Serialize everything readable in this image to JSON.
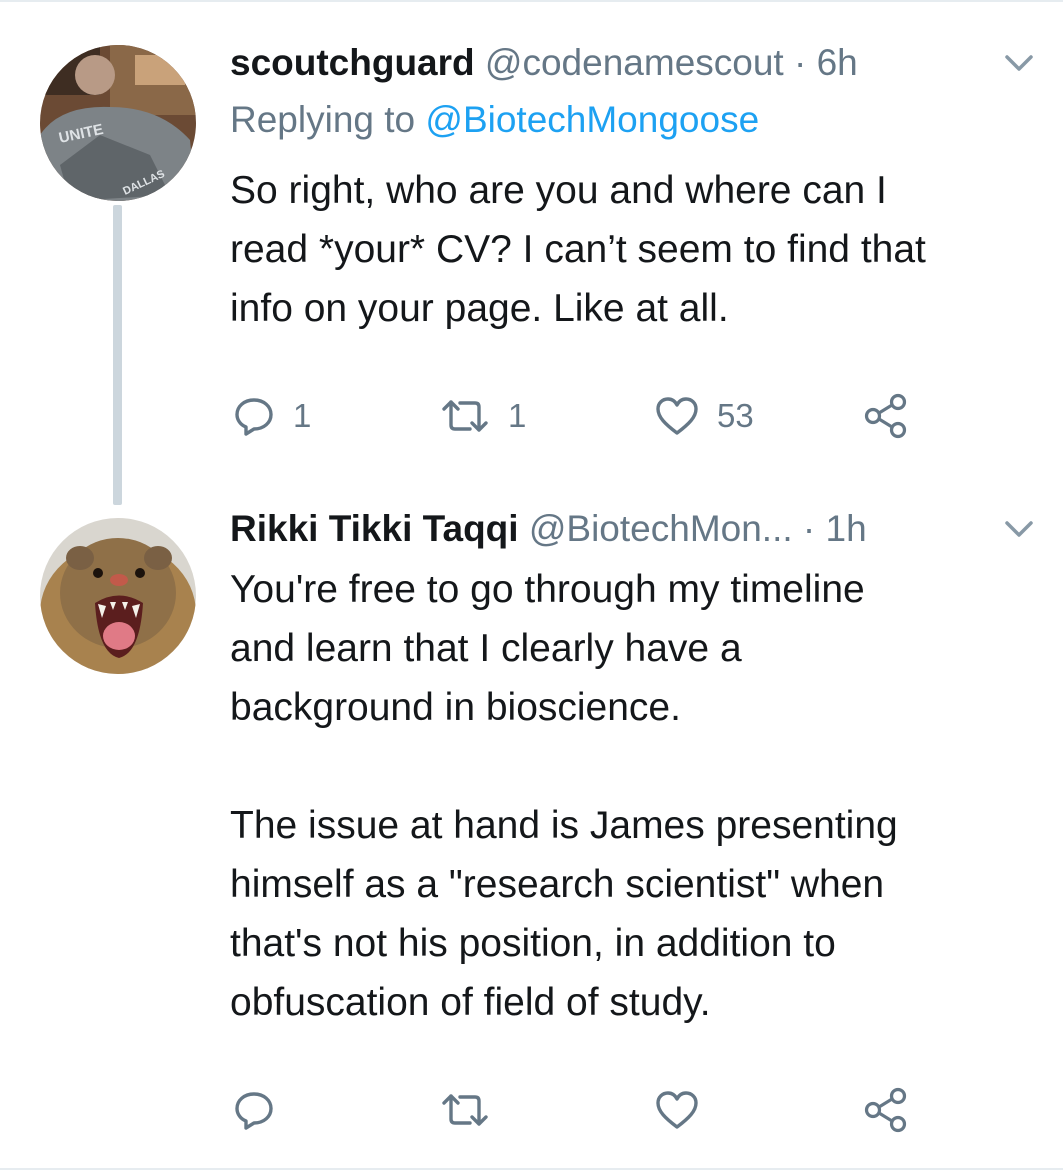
{
  "tweets": [
    {
      "display_name": "scoutchguard",
      "handle": "@codenamescout",
      "separator": "·",
      "time": "6h",
      "replying_prefix": "Replying to",
      "replying_to": "@BiotechMongoose",
      "text": "So right, who are you and where can I\nread *your* CV? I can’t seem to find that\ninfo on your page. Like at all.",
      "avatar_shirt_text": "UNITE",
      "avatar_shirt_text2": "DALLAS",
      "actions": {
        "reply_count": "1",
        "retweet_count": "1",
        "like_count": "53"
      }
    },
    {
      "display_name": "Rikki Tikki Taqqi",
      "handle": "@BiotechMon...",
      "separator": "·",
      "time": "1h",
      "text": "You're free to go through my timeline\nand learn that I clearly have a\nbackground in bioscience.\n\nThe issue at hand is James presenting\nhimself as a \"research scientist\" when\nthat's not his position, in addition to\nobfuscation of field of study.",
      "actions": {
        "reply_count": "",
        "retweet_count": "",
        "like_count": ""
      }
    }
  ],
  "icons": {
    "reply": "reply-icon",
    "retweet": "retweet-icon",
    "like": "like-icon",
    "share": "share-icon",
    "caret": "chevron-down-icon"
  },
  "colors": {
    "text": "#14171a",
    "muted": "#657786",
    "link": "#1da1f2",
    "thread_line": "#ccd6dd",
    "border": "#e6ecf0"
  }
}
